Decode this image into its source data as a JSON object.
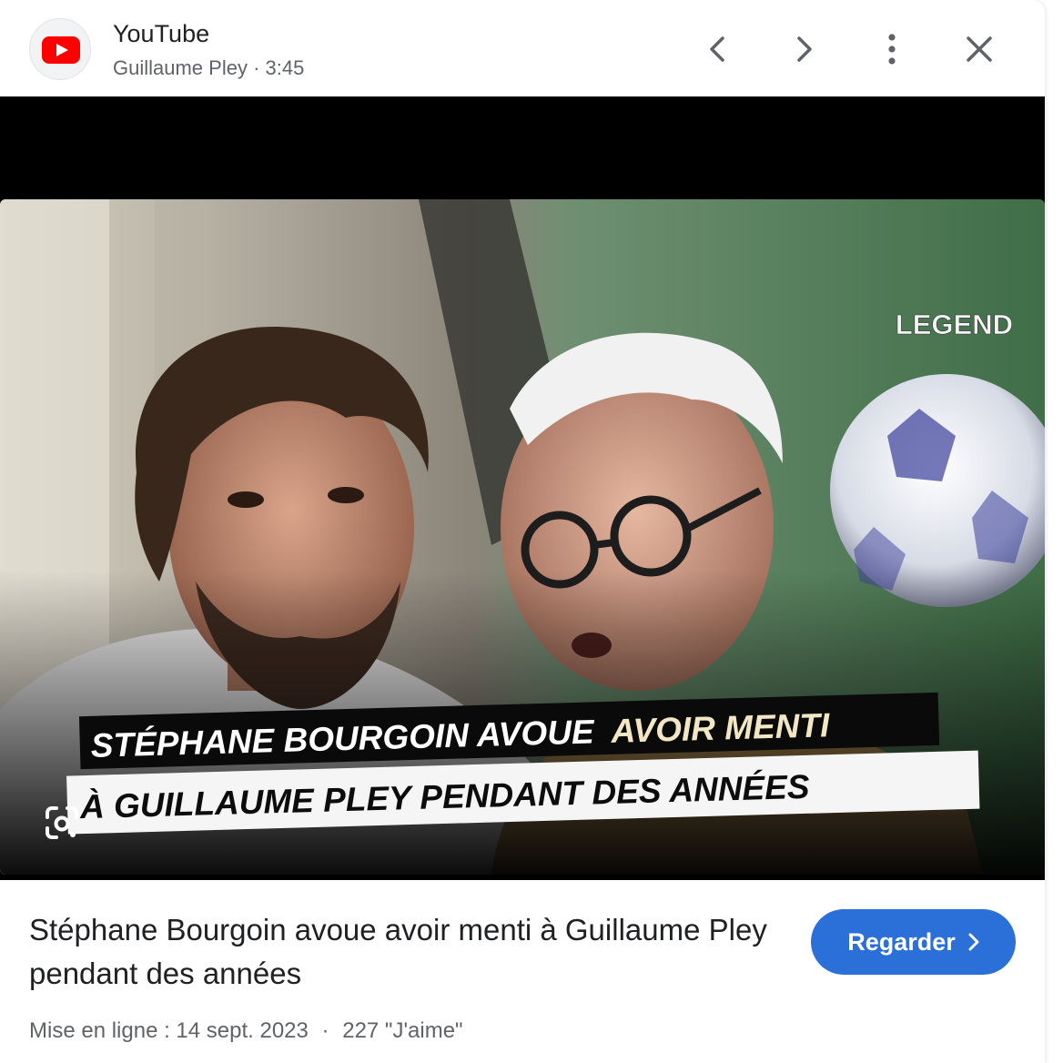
{
  "header": {
    "source_name": "YouTube",
    "channel": "Guillaume Pley",
    "separator": "·",
    "duration": "3:45",
    "icons": [
      "youtube-logo-icon",
      "chevron-left-icon",
      "chevron-right-icon",
      "more-vert-icon",
      "close-icon"
    ]
  },
  "thumbnail": {
    "badge": "LEGEND",
    "caption_line1_white": "STÉPHANE BOURGOIN AVOUE",
    "caption_line1_accent": "AVOIR MENTI",
    "caption_line2": "À GUILLAUME PLEY PENDANT DES ANNÉES",
    "lens_icon": "google-lens-icon"
  },
  "info": {
    "title": "Stéphane Bourgoin avoue avoir menti à Guillaume Pley pendant des années",
    "watch_label": "Regarder",
    "uploaded": "Mise en ligne : 14 sept. 2023",
    "separator": "·",
    "likes": "227 \"J'aime\""
  },
  "colors": {
    "youtube_red": "#ff0000",
    "button_blue": "#2b6fd8",
    "caption_accent": "#f2e7c4",
    "text_primary": "#202124",
    "text_secondary": "#5f6368"
  }
}
